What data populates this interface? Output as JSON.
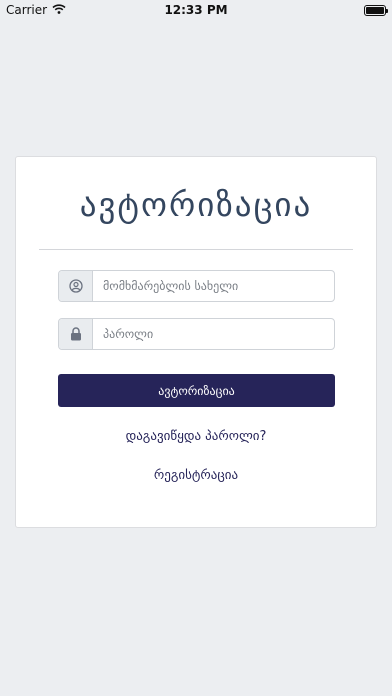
{
  "status_bar": {
    "carrier": "Carrier",
    "time": "12:33 PM",
    "battery_level": 1.0
  },
  "login": {
    "title": "ავტორიზაცია",
    "username_placeholder": "მომხმარებლის სახელი",
    "username_value": "",
    "password_placeholder": "პაროლი",
    "password_value": "",
    "submit_label": "ავტორიზაცია",
    "forgot_password_label": "დაგავიწყდა პაროლი?",
    "register_label": "რეგისტრაცია"
  },
  "icons": {
    "username": "user-circle-icon",
    "password": "lock-icon",
    "wifi": "wifi-icon",
    "battery": "battery-icon"
  },
  "colors": {
    "background": "#eceef1",
    "title": "#34465f",
    "accent": "#262459"
  }
}
